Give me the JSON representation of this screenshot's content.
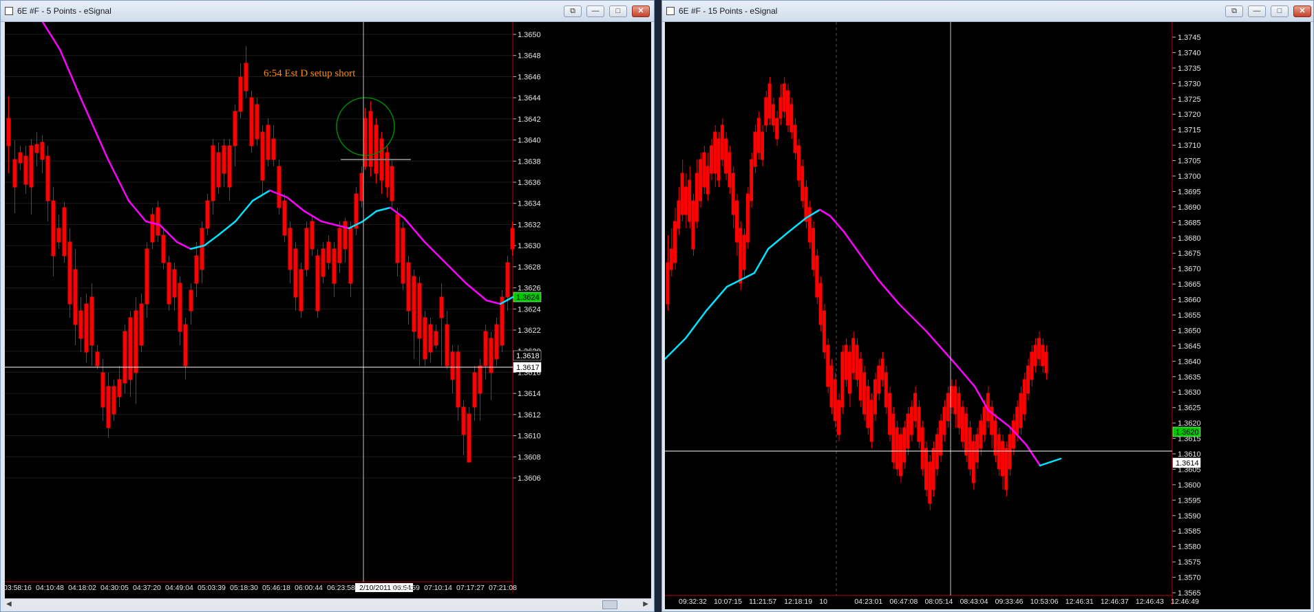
{
  "left_window": {
    "title": "6E #F - 5 Points - eSignal",
    "annotation": "6:54 Est D setup short",
    "y_ticks": [
      "1.3650",
      "1.3648",
      "1.3646",
      "1.3644",
      "1.3642",
      "1.3640",
      "1.3638",
      "1.3636",
      "1.3634",
      "1.3632",
      "1.3630",
      "1.3628",
      "1.3626",
      "1.3624",
      "1.3622",
      "1.3620",
      "1.3618",
      "1.3617",
      "1.3616",
      "1.3614",
      "1.3612",
      "1.3610",
      "1.3608",
      "1.3606"
    ],
    "price_tag_current": "1.3624",
    "price_tag_cursor": "1.3617",
    "price_tag_mid": "1.3618",
    "x_ticks": [
      "03:58:16",
      "04:10:48",
      "04:18:02",
      "04:30:05",
      "04:37:20",
      "04:49:04",
      "05:03:39",
      "05:18:30",
      "05:46:18",
      "06:00:44",
      "06:23:58",
      "2/10/2011 06:54:48",
      "07:04:59",
      "07:10:14",
      "07:17:27",
      "07:21:08"
    ]
  },
  "right_window": {
    "title": "6E #F - 15 Points - eSignal",
    "y_ticks": [
      "1.3745",
      "1.3740",
      "1.3735",
      "1.3730",
      "1.3725",
      "1.3720",
      "1.3715",
      "1.3710",
      "1.3705",
      "1.3700",
      "1.3695",
      "1.3690",
      "1.3685",
      "1.3680",
      "1.3675",
      "1.3670",
      "1.3665",
      "1.3660",
      "1.3655",
      "1.3650",
      "1.3645",
      "1.3640",
      "1.3635",
      "1.3630",
      "1.3625",
      "1.3620",
      "1.3615",
      "1.3610",
      "1.3605",
      "1.3600",
      "1.3595",
      "1.3590",
      "1.3585",
      "1.3580",
      "1.3575",
      "1.3570",
      "1.3565"
    ],
    "price_tag_current": "1.3620",
    "price_tag_cursor": "1.3614",
    "x_ticks": [
      "09:32:32",
      "10:07:15",
      "11:21:57",
      "12:18:19",
      "10",
      "04:23:01",
      "06:47:08",
      "08:05:14",
      "08:43:04",
      "09:33:46",
      "10:53:06",
      "12:46:31",
      "12:46:37",
      "12:46:43",
      "12:46:49"
    ]
  },
  "colors": {
    "up_candle": "#00c800",
    "down_candle": "#ff0000",
    "ma_up": "#00e5ff",
    "ma_down": "#ff00ff",
    "annotation": "#ff8c00",
    "circle": "#008800",
    "crosshair": "#c8c8c8",
    "grid": "#3a3a3a",
    "axis_line": "#c00000"
  },
  "window_buttons": {
    "restore": "⧉",
    "minimize": "—",
    "maximize": "□",
    "close": "✕"
  }
}
